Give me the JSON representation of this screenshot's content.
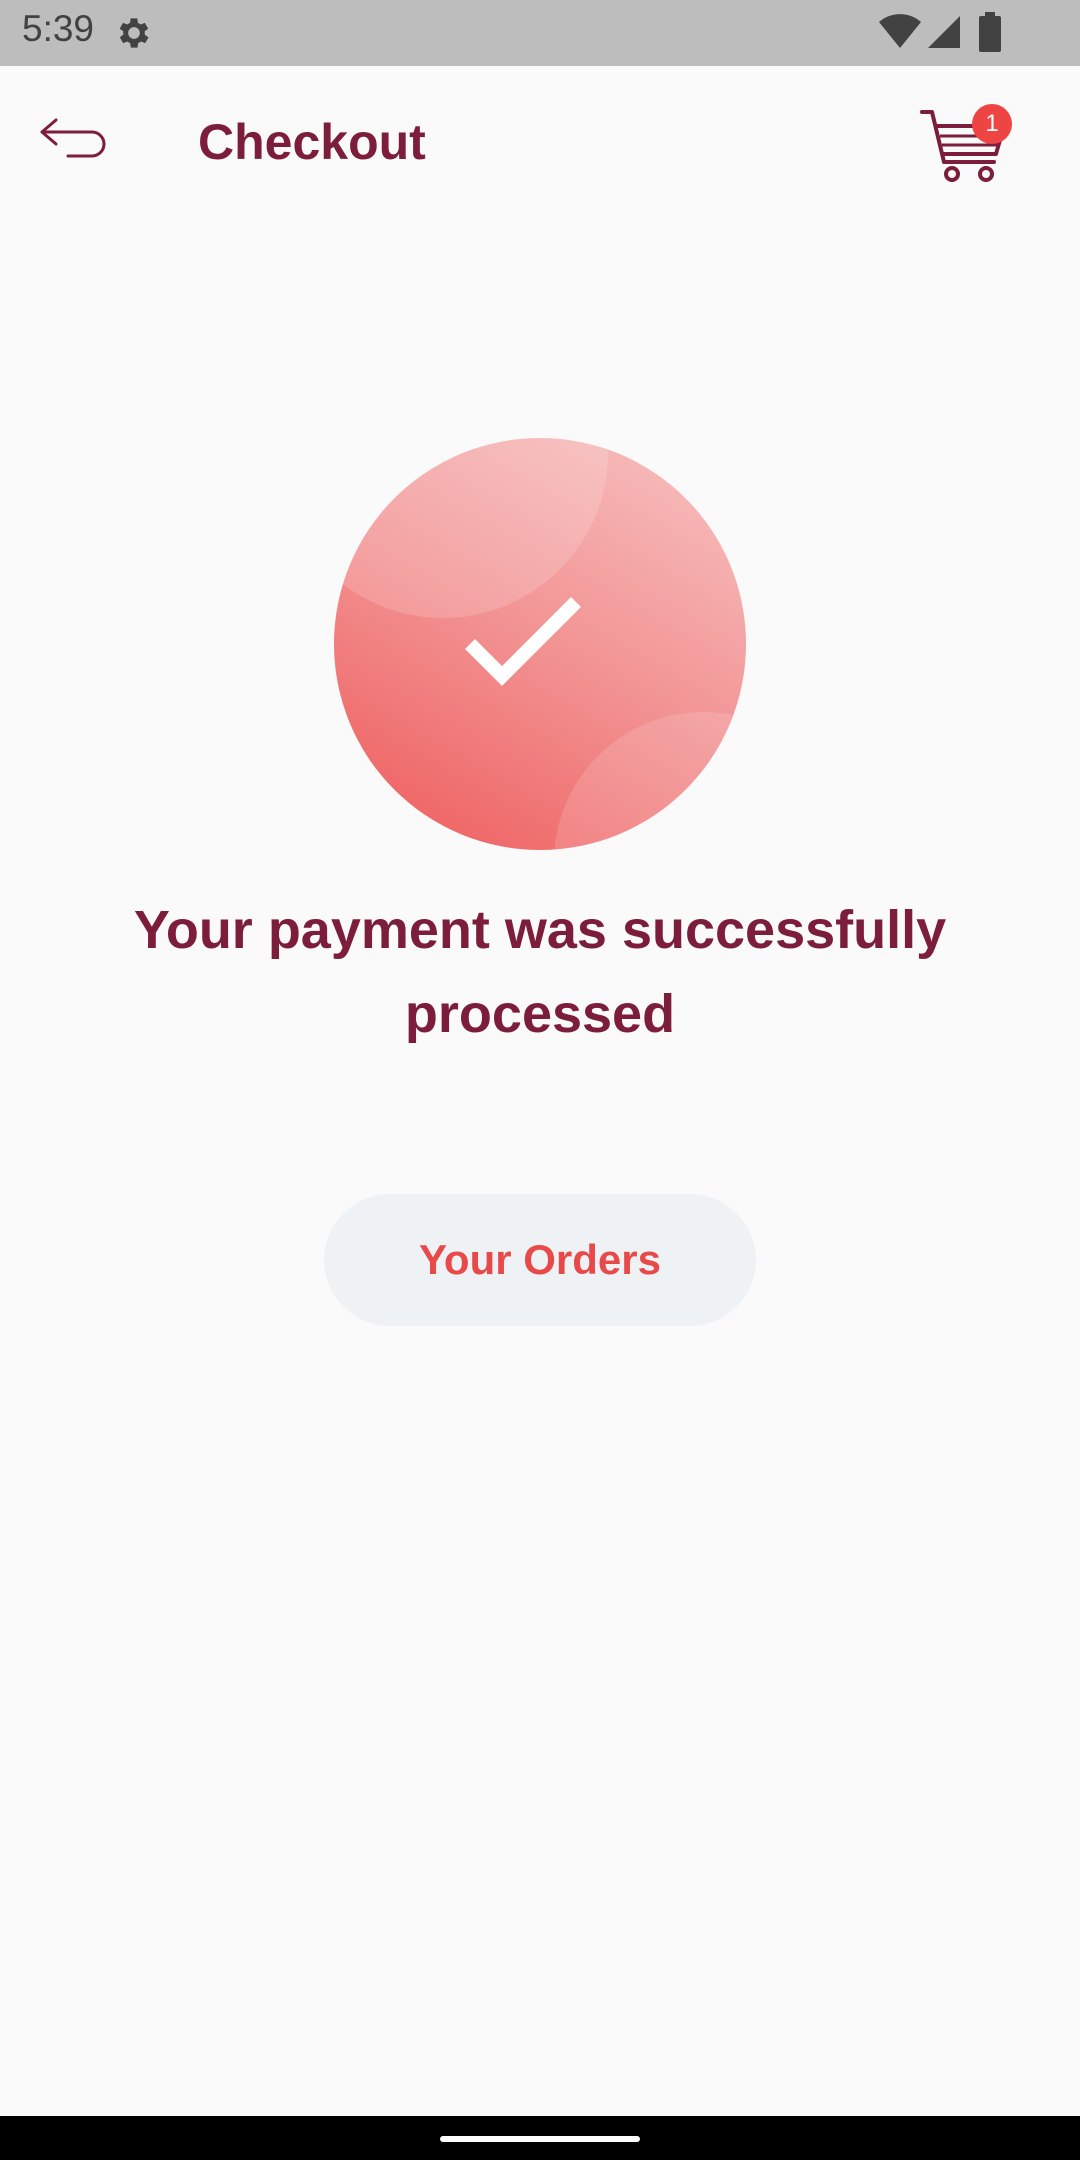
{
  "status_bar": {
    "time": "5:39",
    "icons": [
      "gear-icon",
      "wifi-icon",
      "signal-icon",
      "battery-icon"
    ]
  },
  "header": {
    "title": "Checkout",
    "back_icon": "back-arrow-icon",
    "cart_icon": "cart-icon",
    "cart_count": "1"
  },
  "main": {
    "success_icon": "check-icon",
    "message": "Your payment was successfully processed",
    "orders_button_label": "Your Orders"
  },
  "colors": {
    "primary": "#7b1d3b",
    "accent": "#e84a4a",
    "badge": "#ef4444",
    "button_bg": "#eff2f4",
    "background": "#fafafa"
  }
}
